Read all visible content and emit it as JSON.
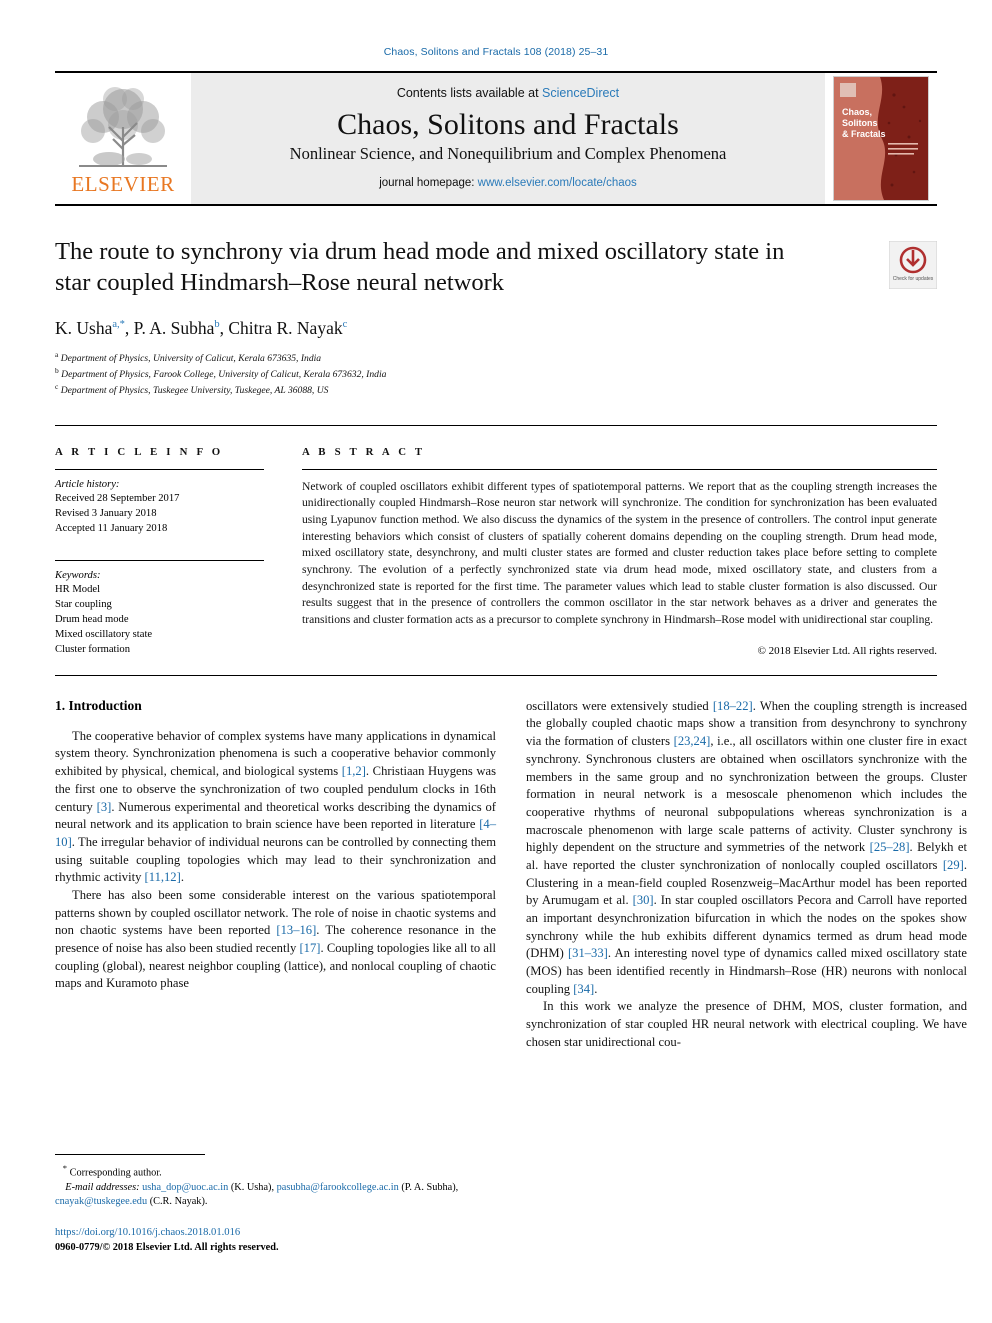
{
  "running_head": "Chaos, Solitons and Fractals 108 (2018) 25–31",
  "masthead": {
    "contents_prefix": "Contents lists available at",
    "contents_link": "ScienceDirect",
    "journal_title": "Chaos, Solitons and Fractals",
    "journal_subtitle": "Nonlinear Science, and Nonequilibrium and Complex Phenomena",
    "homepage_label": "journal homepage:",
    "homepage_url": "www.elsevier.com/locate/chaos",
    "publisher_logo_text": "ELSEVIER",
    "cover_title_line1": "Chaos,",
    "cover_title_line2": "Solitons",
    "cover_title_line3": "& Fractals"
  },
  "article": {
    "title": "The route to synchrony via drum head mode and mixed oscillatory state in star coupled Hindmarsh–Rose neural network",
    "authors": [
      {
        "name": "K. Usha",
        "marks": "a,*"
      },
      {
        "name": "P. A. Subha",
        "marks": "b"
      },
      {
        "name": "Chitra R. Nayak",
        "marks": "c"
      }
    ],
    "affiliations": [
      {
        "mark": "a",
        "text": "Department of Physics, University of Calicut, Kerala 673635, India"
      },
      {
        "mark": "b",
        "text": "Department of Physics, Farook College, University of Calicut, Kerala 673632, India"
      },
      {
        "mark": "c",
        "text": "Department of Physics, Tuskegee University, Tuskegee, AL 36088, US"
      }
    ],
    "crossmark_label": "Check for updates"
  },
  "info": {
    "heading": "A R T I C L E   I N F O",
    "history_label": "Article history:",
    "history": [
      "Received 28 September 2017",
      "Revised 3 January 2018",
      "Accepted 11 January 2018"
    ],
    "keywords_label": "Keywords:",
    "keywords": [
      "HR Model",
      "Star coupling",
      "Drum head mode",
      "Mixed oscillatory state",
      "Cluster formation"
    ]
  },
  "abstract": {
    "heading": "A B S T R A C T",
    "text": "Network of coupled oscillators exhibit different types of spatiotemporal patterns. We report that as the coupling strength increases the unidirectionally coupled Hindmarsh–Rose neuron star network will synchronize. The condition for synchronization has been evaluated using Lyapunov function method. We also discuss the dynamics of the system in the presence of controllers. The control input generate interesting behaviors which consist of clusters of spatially coherent domains depending on the coupling strength. Drum head mode, mixed oscillatory state, desynchrony, and multi cluster states are formed and cluster reduction takes place before setting to complete synchrony. The evolution of a perfectly synchronized state via drum head mode, mixed oscillatory state, and clusters from a desynchronized state is reported for the first time. The parameter values which lead to stable cluster formation is also discussed. Our results suggest that in the presence of controllers the common oscillator in the star network behaves as a driver and generates the transitions and cluster formation acts as a precursor to complete synchrony in Hindmarsh–Rose model with unidirectional star coupling.",
    "copyright": "© 2018 Elsevier Ltd. All rights reserved."
  },
  "body": {
    "section_heading": "1. Introduction",
    "left_paragraphs": [
      {
        "parts": [
          {
            "t": "The cooperative behavior of complex systems have many applications in dynamical system theory. Synchronization phenomena is such a cooperative behavior commonly exhibited by physical, chemical, and biological systems "
          },
          {
            "t": "[1,2]",
            "cite": true
          },
          {
            "t": ". Christiaan Huygens was the first one to observe the synchronization of two coupled pendulum clocks in 16th century "
          },
          {
            "t": "[3]",
            "cite": true
          },
          {
            "t": ". Numerous experimental and theoretical works describing the dynamics of neural network and its application to brain science have been reported in literature "
          },
          {
            "t": "[4–10]",
            "cite": true
          },
          {
            "t": ". The irregular behavior of individual neurons can be controlled by connecting them using suitable coupling topologies which may lead to their synchronization and rhythmic activity "
          },
          {
            "t": "[11,12]",
            "cite": true
          },
          {
            "t": "."
          }
        ]
      },
      {
        "parts": [
          {
            "t": "There has also been some considerable interest on the various spatiotemporal patterns shown by coupled oscillator network. The role of noise in chaotic systems and non chaotic systems have been reported "
          },
          {
            "t": "[13–16]",
            "cite": true
          },
          {
            "t": ". The coherence resonance in the presence of noise has also been studied recently "
          },
          {
            "t": "[17]",
            "cite": true
          },
          {
            "t": ". Coupling topologies like all to all coupling (global), nearest neighbor coupling (lattice), and nonlocal coupling of chaotic maps and Kuramoto phase"
          }
        ]
      }
    ],
    "right_paragraphs": [
      {
        "parts": [
          {
            "t": "oscillators were extensively studied "
          },
          {
            "t": "[18–22]",
            "cite": true
          },
          {
            "t": ". When the coupling strength is increased the globally coupled chaotic maps show a transition from desynchrony to synchrony via the formation of clusters "
          },
          {
            "t": "[23,24]",
            "cite": true
          },
          {
            "t": ", i.e., all oscillators within one cluster fire in exact synchrony. Synchronous clusters are obtained when oscillators synchronize with the members in the same group and no synchronization between the groups. Cluster formation in neural network is a mesoscale phenomenon which includes the cooperative rhythms of neuronal subpopulations whereas synchronization is a macroscale phenomenon with large scale patterns of activity. Cluster synchrony is highly dependent on the structure and symmetries of the network "
          },
          {
            "t": "[25–28]",
            "cite": true
          },
          {
            "t": ". Belykh et al. have reported the cluster synchronization of nonlocally coupled oscillators "
          },
          {
            "t": "[29]",
            "cite": true
          },
          {
            "t": ". Clustering in a mean-field coupled Rosenzweig–MacArthur model has been reported by Arumugam et al. "
          },
          {
            "t": "[30]",
            "cite": true
          },
          {
            "t": ". In star coupled oscillators Pecora and Carroll have reported an important desynchronization bifurcation in which the nodes on the spokes show synchrony while the hub exhibits different dynamics termed as drum head mode (DHM) "
          },
          {
            "t": "[31–33]",
            "cite": true
          },
          {
            "t": ". An interesting novel type of dynamics called mixed oscillatory state (MOS) has been identified recently in Hindmarsh–Rose (HR) neurons with nonlocal coupling "
          },
          {
            "t": "[34]",
            "cite": true
          },
          {
            "t": "."
          }
        ]
      },
      {
        "parts": [
          {
            "t": "In this work we analyze the presence of DHM, MOS, cluster formation, and synchronization of star coupled HR neural network with electrical coupling. We have chosen star unidirectional cou-"
          }
        ]
      }
    ]
  },
  "footnotes": {
    "corresponding_marker": "*",
    "corresponding_label": "Corresponding author.",
    "email_label": "E-mail addresses:",
    "emails": [
      {
        "address": "usha_dop@uoc.ac.in",
        "owner": "(K. Usha)"
      },
      {
        "address": "pasubha@farookcollege.ac.in",
        "owner": "(P. A. Subha)"
      },
      {
        "address": "cnayak@tuskegee.edu",
        "owner": "(C.R. Nayak)"
      }
    ],
    "doi": "https://doi.org/10.1016/j.chaos.2018.01.016",
    "issn_line": "0960-0779/© 2018 Elsevier Ltd. All rights reserved."
  },
  "colors": {
    "link_blue": "#1a6aa8",
    "science_direct_blue": "#2a7ab9",
    "elsevier_orange": "#E87722",
    "masthead_grey": "#ececec"
  }
}
